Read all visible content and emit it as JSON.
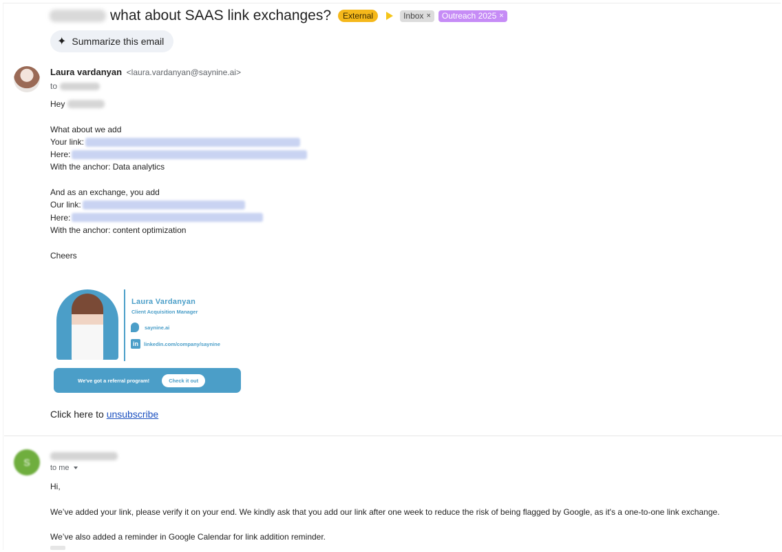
{
  "header": {
    "subject": "what about SAAS link exchanges?",
    "labels": {
      "external": "External",
      "inbox": "Inbox",
      "outreach": "Outreach 2025",
      "remove_glyph": "×"
    },
    "summarize_label": "Summarize this email"
  },
  "message1": {
    "sender_name": "Laura vardanyan",
    "sender_email": "<laura.vardanyan@saynine.ai>",
    "to_label": "to",
    "greeting": "Hey",
    "line_intro": "What about we add",
    "your_link_label": "Your link:",
    "here_label_1": "Here:",
    "anchor_line_1": "With the anchor: Data analytics",
    "exchange_intro": "And as an exchange, you add",
    "our_link_label": "Our link:",
    "here_label_2": "Here:",
    "anchor_line_2": "With the anchor: content optimization",
    "closing": "Cheers",
    "signature": {
      "name": "Laura Vardanyan",
      "title": "Client Acquisition Manager",
      "website": "saynine.ai",
      "linkedin": "linkedin.com/company/saynine",
      "linkedin_glyph": "in",
      "referral_text": "We've got a referral program!",
      "referral_button": "Check it out"
    },
    "unsubscribe_prefix": "Click here to",
    "unsubscribe_link": "unsubscribe"
  },
  "message2": {
    "avatar_letter": "S",
    "to_label": "to me",
    "greeting": "Hi,",
    "paragraph1": "We’ve added your link, please verify it on your end. We kindly ask that you add our link after one week to reduce the risk of being flagged by Google, as it's a one-to-one link exchange.",
    "paragraph2": "We’ve also added a reminder in Google Calendar for link addition reminder."
  },
  "colors": {
    "external_chip": "#f5b81b",
    "outreach_chip": "#c68cf6",
    "brand_blue": "#4b9ec8",
    "link_blue": "#1a4fbf"
  }
}
